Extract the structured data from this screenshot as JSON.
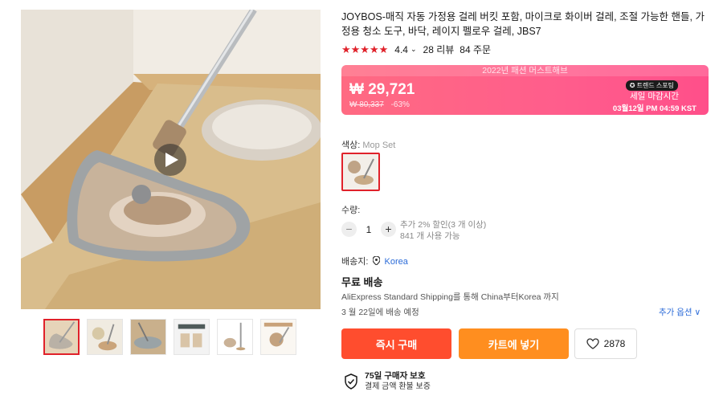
{
  "product": {
    "title": "JOYBOS-매직 자동 가정용 걸레 버킷 포함, 마이크로 화이버 걸레, 조절 가능한 핸들, 가정용 청소 도구, 바닥, 레이지 펠로우 걸레, JBS7",
    "rating": "4.4",
    "reviews": "28 리뷰",
    "orders": "84 주문"
  },
  "price_banner": {
    "top_label": "2022년 패션 머스트해브",
    "price_now": "₩ 29,721",
    "price_old": "₩ 80,337",
    "discount": "-63%",
    "trend_badge": "✪ 트렌드 스포팅",
    "sale_end_label": "세일 마감시간",
    "sale_end_time": "03월12일 PM 04:59 KST"
  },
  "color": {
    "label": "색상:",
    "value": "Mop Set"
  },
  "quantity": {
    "label": "수량:",
    "value": "1",
    "minus": "−",
    "plus": "+",
    "discount_note": "추가 2% 할인(3 개 이상)",
    "available": "841 개 사용 가능"
  },
  "shipping": {
    "ship_to_label": "배송지:",
    "ship_to_value": "Korea",
    "free_label": "무료 배송",
    "method": "AliExpress Standard Shipping를 통해 China부터Korea 까지",
    "eta": "3 월 22일에 배송 예정",
    "more_options": "추가 옵션 ∨"
  },
  "actions": {
    "buy_now": "즉시 구매",
    "add_to_cart": "카트에 넣기",
    "wishlist_count": "2878"
  },
  "protection": {
    "title": "75일 구매자 보호",
    "subtitle": "결제 금액 환불 보증"
  },
  "icons": {
    "play": "play-icon",
    "heart": "heart-icon",
    "shield": "shield-check-icon",
    "location": "location-pin-icon"
  },
  "colors": {
    "accent_red": "#e0212a",
    "buy_button": "#ff4d2e",
    "cart_button": "#ff8e1f",
    "banner_pink": "#ff5d8c",
    "link_blue": "#2b6bd8"
  }
}
